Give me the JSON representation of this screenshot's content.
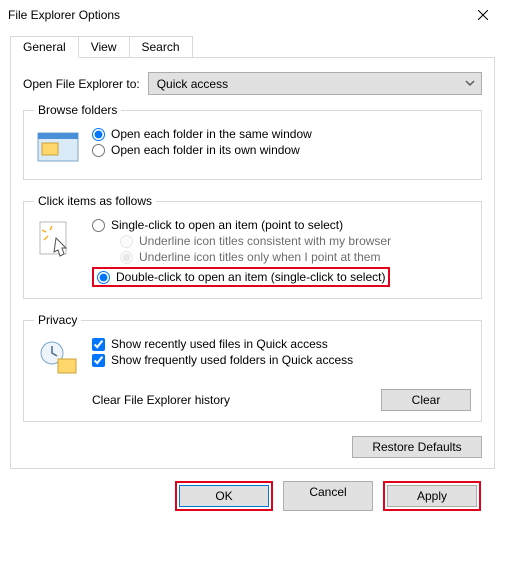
{
  "title": "File Explorer Options",
  "tabs": {
    "general": "General",
    "view": "View",
    "search": "Search"
  },
  "open_to": {
    "label": "Open File Explorer to:",
    "value": "Quick access"
  },
  "browse": {
    "legend": "Browse folders",
    "same_window": "Open each folder in the same window",
    "own_window": "Open each folder in its own window"
  },
  "click": {
    "legend": "Click items as follows",
    "single": "Single-click to open an item (point to select)",
    "underline_browser": "Underline icon titles consistent with my browser",
    "underline_point": "Underline icon titles only when I point at them",
    "double": "Double-click to open an item (single-click to select)"
  },
  "privacy": {
    "legend": "Privacy",
    "recent_files": "Show recently used files in Quick access",
    "freq_folders": "Show frequently used folders in Quick access",
    "clear_label": "Clear File Explorer history",
    "clear_btn": "Clear"
  },
  "restore": "Restore Defaults",
  "buttons": {
    "ok": "OK",
    "cancel": "Cancel",
    "apply": "Apply"
  }
}
